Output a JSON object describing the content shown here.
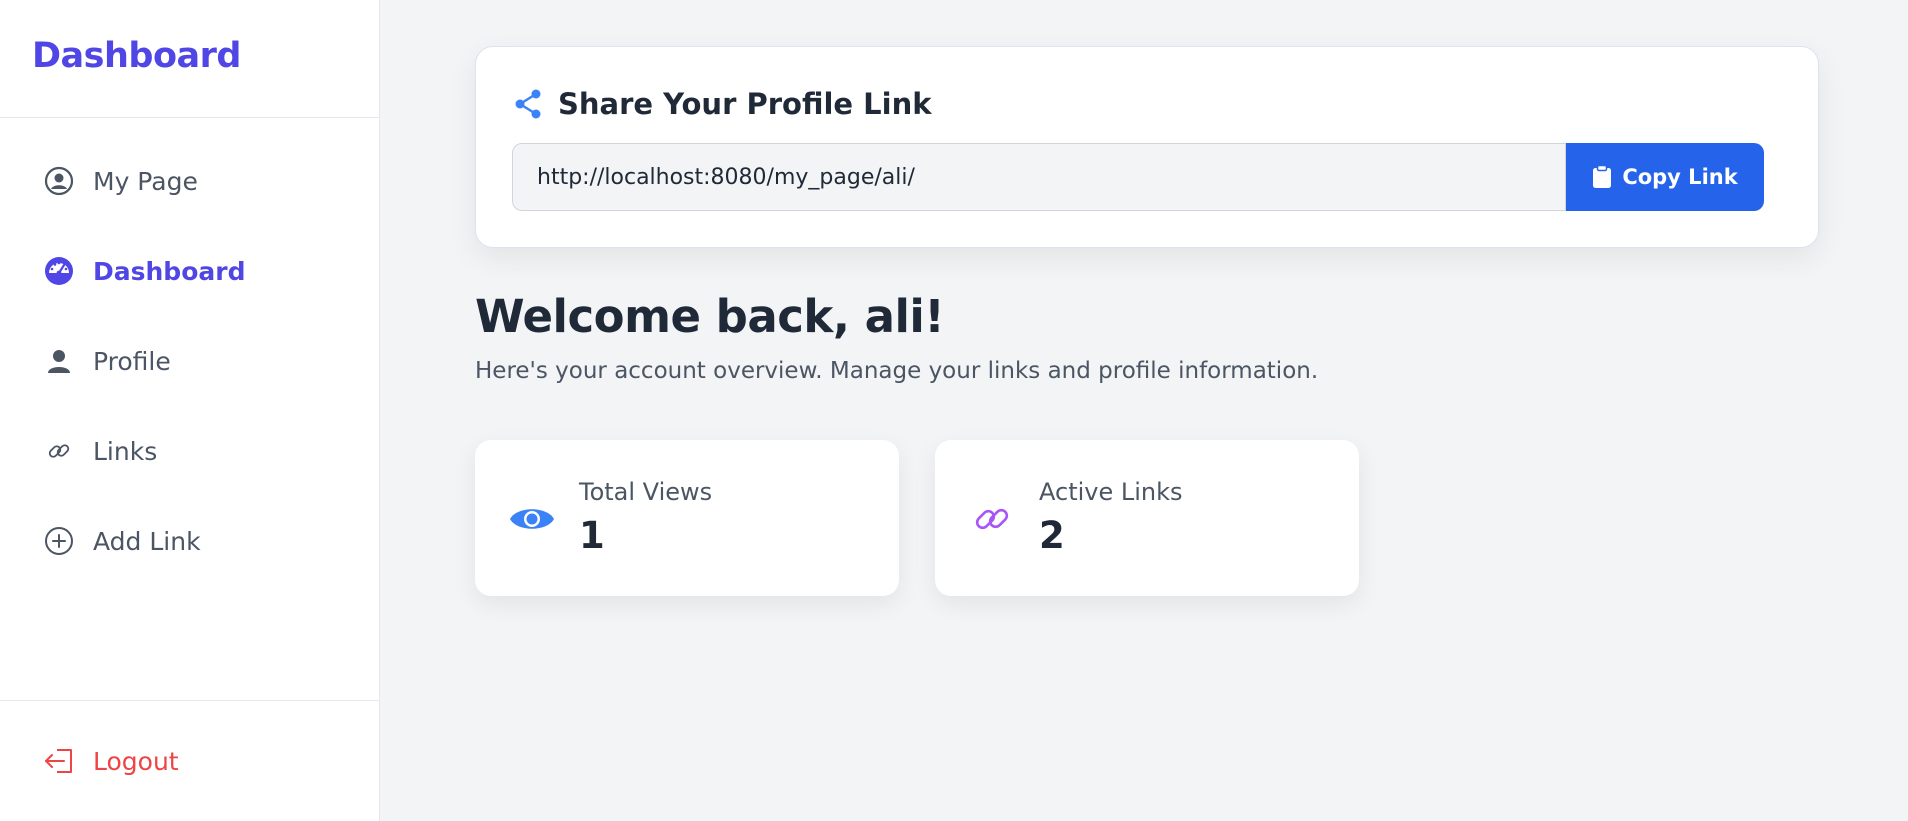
{
  "sidebar": {
    "brand": "Dashboard",
    "items": [
      {
        "label": "My Page",
        "icon": "user-circle-icon"
      },
      {
        "label": "Dashboard",
        "icon": "gauge-icon",
        "active": true
      },
      {
        "label": "Profile",
        "icon": "user-icon"
      },
      {
        "label": "Links",
        "icon": "link-icon"
      },
      {
        "label": "Add Link",
        "icon": "plus-circle-icon"
      }
    ],
    "logout": "Logout"
  },
  "share": {
    "title": "Share Your Profile Link",
    "url": "http://localhost:8080/my_page/ali/",
    "copy_label": "Copy Link"
  },
  "welcome": {
    "title": "Welcome back, ali!",
    "subtitle": "Here's your account overview. Manage your links and profile information."
  },
  "stats": [
    {
      "label": "Total Views",
      "value": "1",
      "icon": "eye-icon"
    },
    {
      "label": "Active Links",
      "value": "2",
      "icon": "link-icon"
    }
  ],
  "colors": {
    "brand": "#4f46e5",
    "primary": "#2563eb",
    "danger": "#ef4444",
    "purple": "#a855f7",
    "muted": "#4b5563"
  }
}
